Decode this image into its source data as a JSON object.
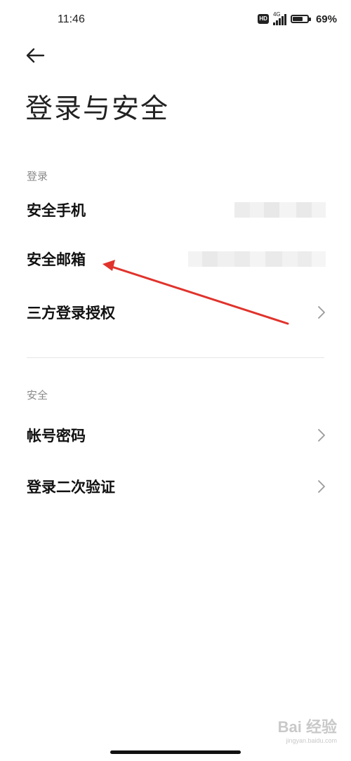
{
  "status": {
    "time": "11:46",
    "hd": "HD",
    "network": "4G",
    "battery_text": "69%",
    "battery_level": 0.69
  },
  "header": {
    "back_icon": "arrow-left-icon",
    "title": "登录与安全"
  },
  "sections": {
    "login": {
      "header": "登录",
      "items": [
        {
          "label": "安全手机"
        },
        {
          "label": "安全邮箱"
        },
        {
          "label": "三方登录授权"
        }
      ]
    },
    "security": {
      "header": "安全",
      "items": [
        {
          "label": "帐号密码"
        },
        {
          "label": "登录二次验证"
        }
      ]
    }
  },
  "colors": {
    "annotation_arrow": "#e0332c",
    "section_header": "#8a8a8a"
  },
  "watermark": {
    "text": "Bai 经验",
    "sub": "jingyan.baidu.com"
  }
}
